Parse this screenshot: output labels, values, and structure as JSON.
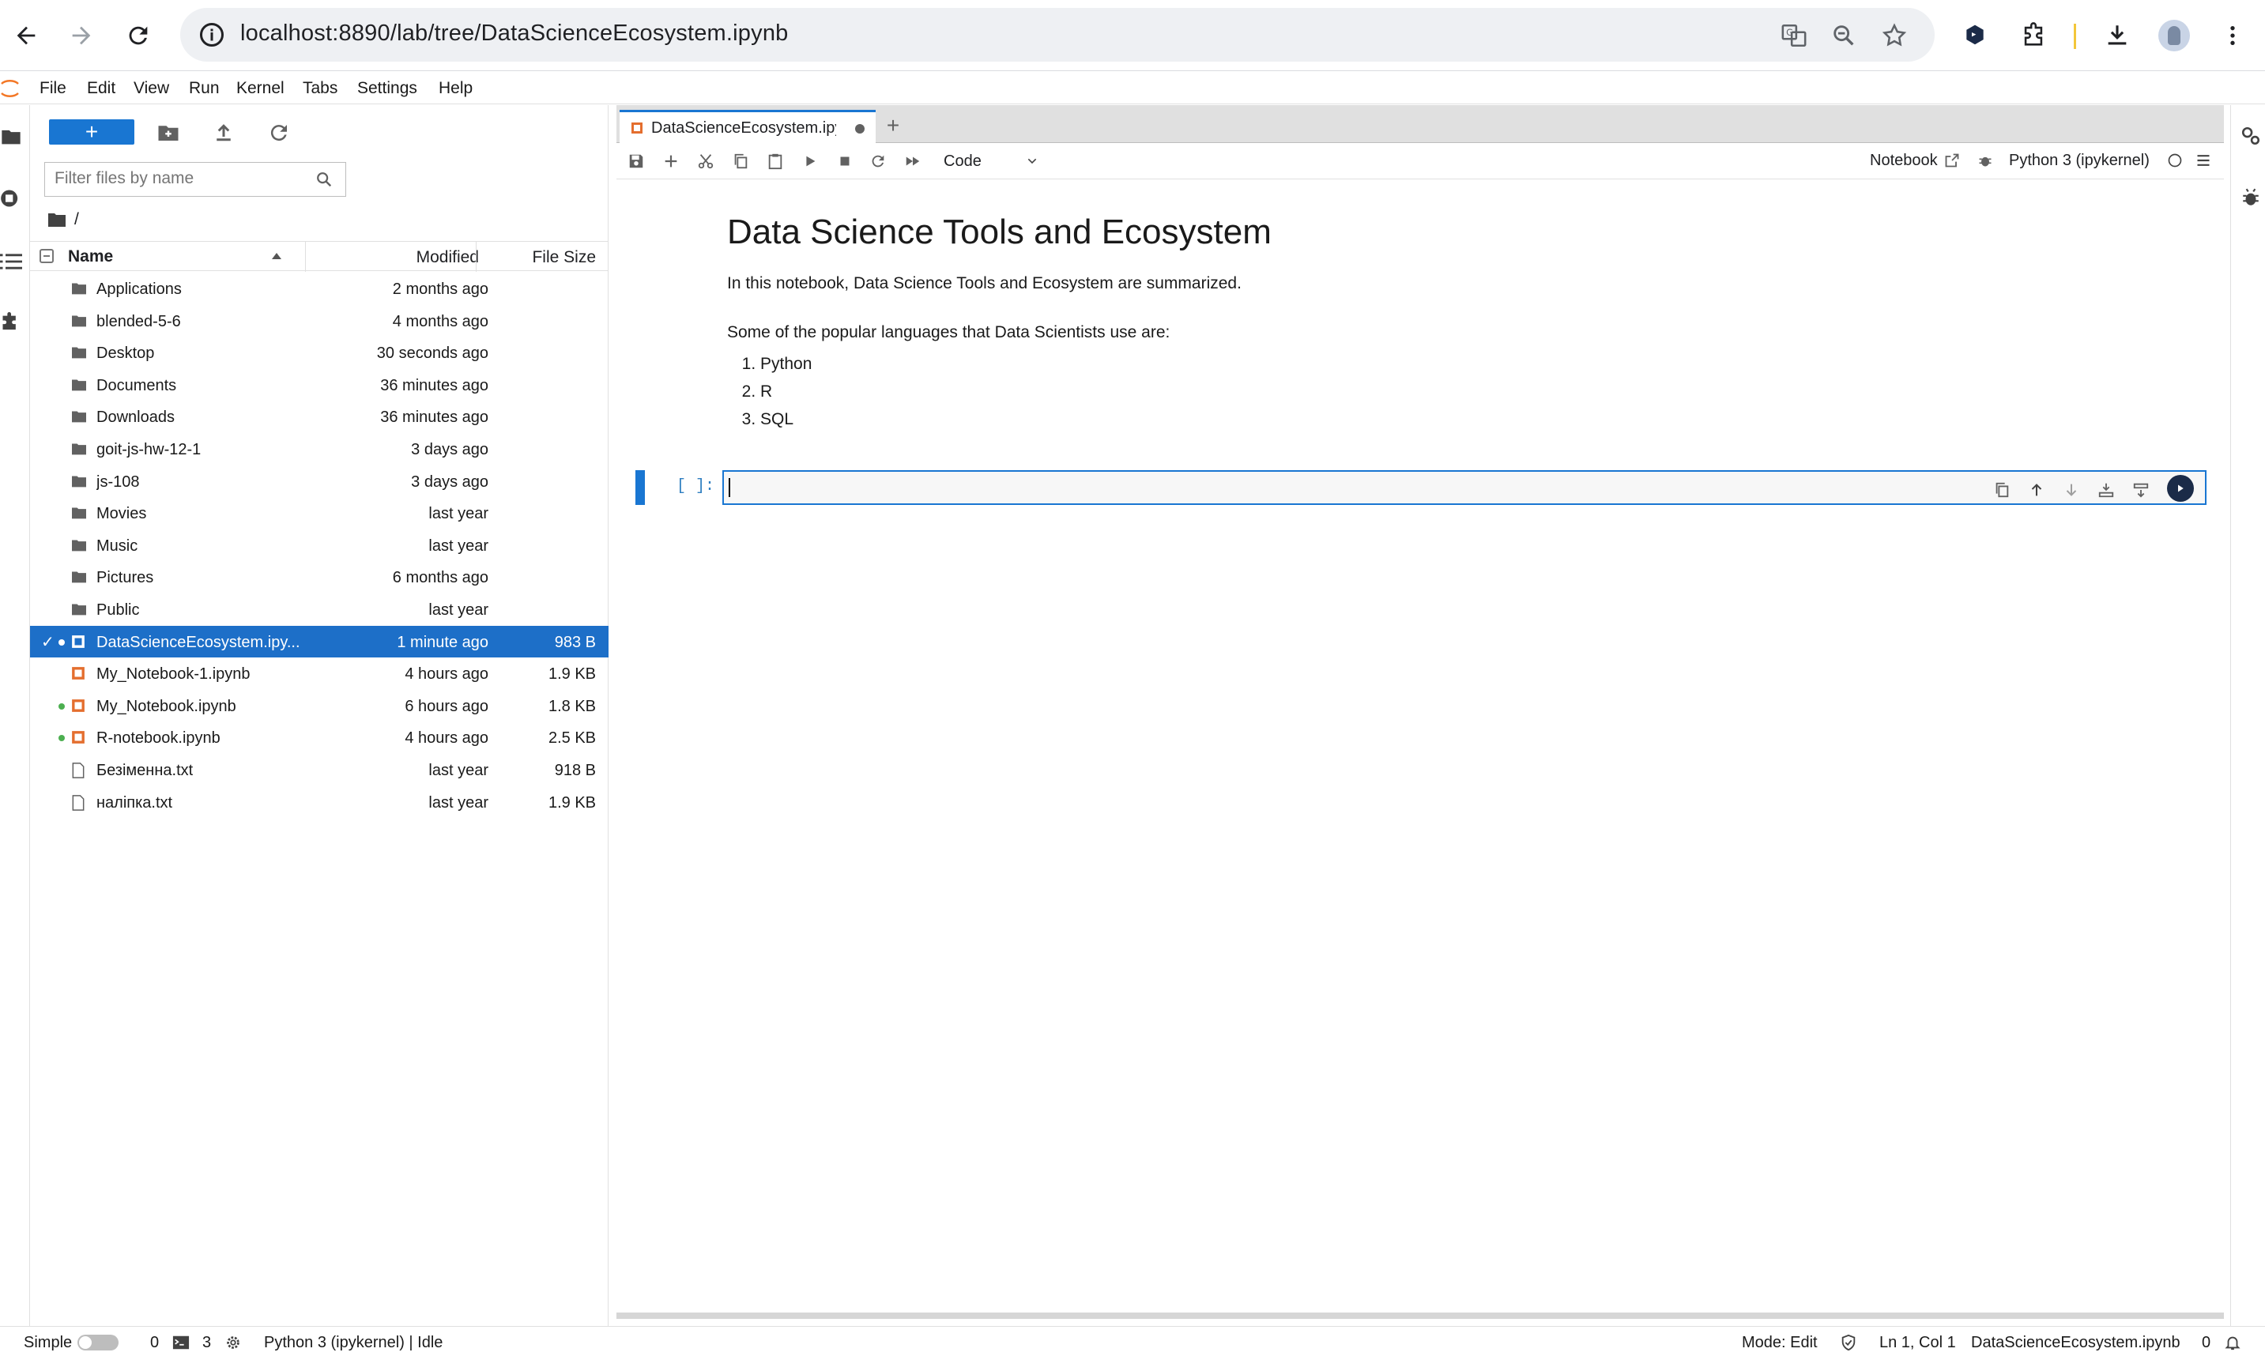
{
  "browser": {
    "url": "localhost:8890/lab/tree/DataScienceEcosystem.ipynb"
  },
  "menubar": {
    "items": [
      "File",
      "Edit",
      "View",
      "Run",
      "Kernel",
      "Tabs",
      "Settings",
      "Help"
    ]
  },
  "filebrowser": {
    "new_label": "+",
    "filter_placeholder": "Filter files by name",
    "path": "/",
    "headers": {
      "name": "Name",
      "modified": "Modified",
      "size": "File Size"
    },
    "files": [
      {
        "name": "Applications",
        "modified": "2 months ago",
        "size": "",
        "type": "folder"
      },
      {
        "name": "blended-5-6",
        "modified": "4 months ago",
        "size": "",
        "type": "folder"
      },
      {
        "name": "Desktop",
        "modified": "30 seconds ago",
        "size": "",
        "type": "folder"
      },
      {
        "name": "Documents",
        "modified": "36 minutes ago",
        "size": "",
        "type": "folder"
      },
      {
        "name": "Downloads",
        "modified": "36 minutes ago",
        "size": "",
        "type": "folder"
      },
      {
        "name": "goit-js-hw-12-1",
        "modified": "3 days ago",
        "size": "",
        "type": "folder"
      },
      {
        "name": "js-108",
        "modified": "3 days ago",
        "size": "",
        "type": "folder"
      },
      {
        "name": "Movies",
        "modified": "last year",
        "size": "",
        "type": "folder"
      },
      {
        "name": "Music",
        "modified": "last year",
        "size": "",
        "type": "folder"
      },
      {
        "name": "Pictures",
        "modified": "6 months ago",
        "size": "",
        "type": "folder"
      },
      {
        "name": "Public",
        "modified": "last year",
        "size": "",
        "type": "folder"
      },
      {
        "name": "DataScienceEcosystem.ipy...",
        "modified": "1 minute ago",
        "size": "983 B",
        "type": "notebook",
        "selected": true,
        "running": true
      },
      {
        "name": "My_Notebook-1.ipynb",
        "modified": "4 hours ago",
        "size": "1.9 KB",
        "type": "notebook"
      },
      {
        "name": "My_Notebook.ipynb",
        "modified": "6 hours ago",
        "size": "1.8 KB",
        "type": "notebook",
        "running": true
      },
      {
        "name": "R-notebook.ipynb",
        "modified": "4 hours ago",
        "size": "2.5 KB",
        "type": "notebook",
        "running": true
      },
      {
        "name": "Безіменна.txt",
        "modified": "last year",
        "size": "918 B",
        "type": "file"
      },
      {
        "name": "налiпка.txt",
        "modified": "last year",
        "size": "1.9 KB",
        "type": "file"
      }
    ]
  },
  "notebook": {
    "tab_title": "DataScienceEcosystem.ipynb",
    "cell_type": "Code",
    "notebook_link": "Notebook",
    "kernel": "Python 3 (ipykernel)",
    "heading": "Data Science Tools and Ecosystem",
    "intro": "In this notebook, Data Science Tools and Ecosystem are summarized.",
    "languages_intro": "Some of the popular languages that Data Scientists use are:",
    "languages": [
      "Python",
      "R",
      "SQL"
    ],
    "prompt": "[ ]:"
  },
  "statusbar": {
    "mode_label": "Simple",
    "terminals": "0",
    "kernels": "3",
    "kernel_status": "Python 3 (ipykernel) | Idle",
    "edit_mode": "Mode: Edit",
    "cursor": "Ln 1, Col 1",
    "filename": "DataScienceEcosystem.ipynb",
    "notifications": "0"
  },
  "colors": {
    "accent": "#1976d2",
    "selected_row": "#1d6fc8",
    "running_dot": "#4caf50",
    "notebook_icon": "#e46e2e"
  }
}
